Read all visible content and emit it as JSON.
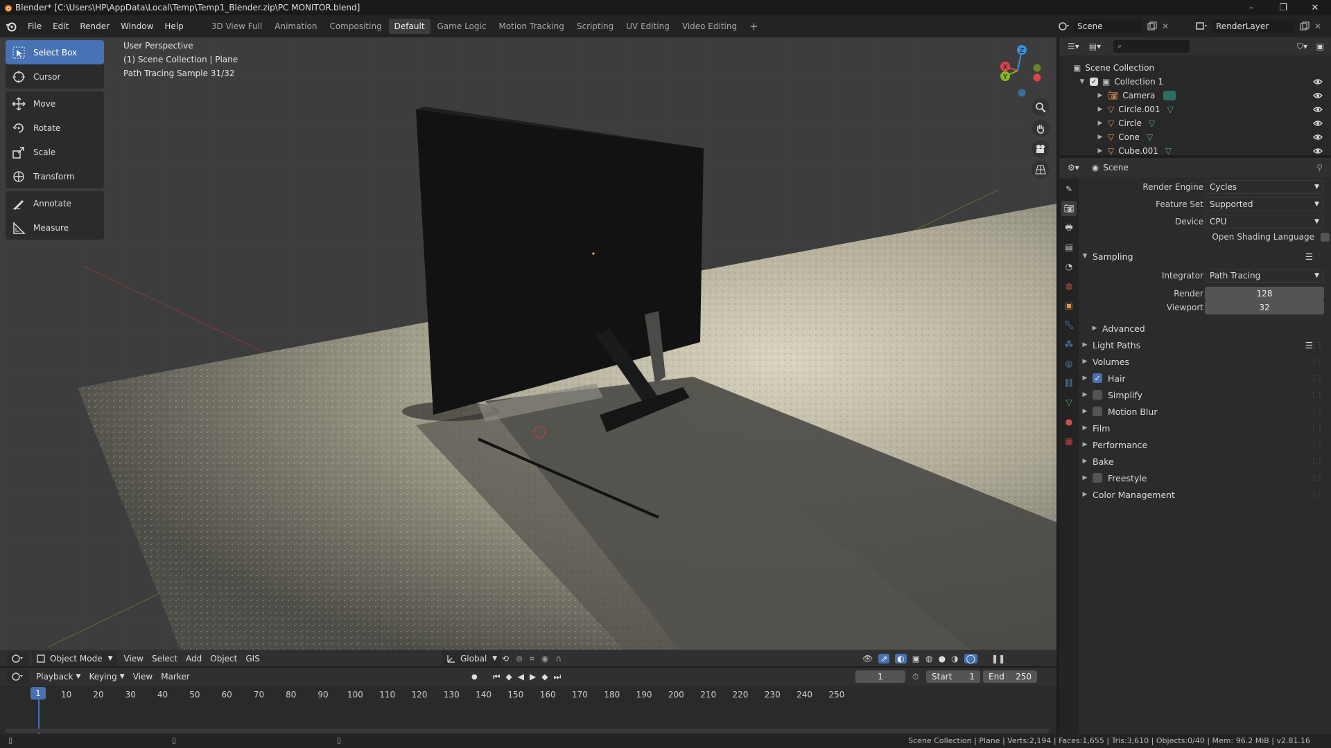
{
  "window": {
    "title": "Blender* [C:\\Users\\HP\\AppData\\Local\\Temp\\Temp1_Blender.zip\\PC MONITOR.blend]",
    "controls": [
      "–",
      "❐",
      "✕"
    ]
  },
  "topbar": {
    "menus": [
      "File",
      "Edit",
      "Render",
      "Window",
      "Help"
    ],
    "workspaces": [
      "3D View Full",
      "Animation",
      "Compositing",
      "Default",
      "Game Logic",
      "Motion Tracking",
      "Scripting",
      "UV Editing",
      "Video Editing"
    ],
    "active_workspace": "Default",
    "add_tab": "+",
    "scene": "Scene",
    "view_layer": "RenderLayer"
  },
  "viewport": {
    "info": [
      "User Perspective",
      "(1) Scene Collection | Plane",
      "Path Tracing Sample 31/32"
    ],
    "tools": [
      {
        "label": "Select Box",
        "icon": "select-box-icon",
        "active": true
      },
      {
        "label": "Cursor",
        "icon": "cursor-icon"
      },
      {
        "label": "Move",
        "icon": "move-icon"
      },
      {
        "label": "Rotate",
        "icon": "rotate-icon"
      },
      {
        "label": "Scale",
        "icon": "scale-icon"
      },
      {
        "label": "Transform",
        "icon": "transform-icon"
      },
      {
        "label": "Annotate",
        "icon": "annotate-icon"
      },
      {
        "label": "Measure",
        "icon": "measure-icon"
      }
    ],
    "gizmo_axes": {
      "x": "X",
      "y": "Y",
      "z": "Z"
    },
    "header": {
      "mode": "Object Mode",
      "menus": [
        "View",
        "Select",
        "Add",
        "Object",
        "GIS"
      ],
      "orientation": "Global"
    }
  },
  "timeline": {
    "menus": [
      "Playback",
      "Keying",
      "View",
      "Marker"
    ],
    "current_frame": "1",
    "start_label": "Start",
    "start": "1",
    "end_label": "End",
    "end": "250",
    "ticks": [
      10,
      20,
      30,
      40,
      50,
      60,
      70,
      80,
      90,
      100,
      110,
      120,
      130,
      140,
      150,
      160,
      170,
      180,
      190,
      200,
      210,
      220,
      230,
      240,
      250
    ],
    "cursor_label": "1"
  },
  "statusbar": {
    "stats": "Scene Collection | Plane | Verts:2,194 | Faces:1,655 | Tris:3,610 | Objects:0/40 | Mem: 96.2 MiB | v2.81.16"
  },
  "outliner": {
    "root": "Scene Collection",
    "collection": "Collection 1",
    "items": [
      {
        "name": "Camera",
        "icon": "camera-object-icon"
      },
      {
        "name": "Circle.001",
        "icon": "mesh-object-icon"
      },
      {
        "name": "Circle",
        "icon": "mesh-object-icon"
      },
      {
        "name": "Cone",
        "icon": "mesh-object-icon"
      },
      {
        "name": "Cube.001",
        "icon": "mesh-object-icon"
      }
    ]
  },
  "properties": {
    "context": "Scene",
    "render_engine_label": "Render Engine",
    "render_engine": "Cycles",
    "feature_set_label": "Feature Set",
    "feature_set": "Supported",
    "device_label": "Device",
    "device": "CPU",
    "osl_label": "Open Shading Language",
    "sampling": {
      "title": "Sampling",
      "integrator_label": "Integrator",
      "integrator": "Path Tracing",
      "render_label": "Render",
      "render": "128",
      "viewport_label": "Viewport",
      "viewport": "32",
      "advanced": "Advanced"
    },
    "panels": [
      {
        "label": "Light Paths",
        "checkbox": null
      },
      {
        "label": "Volumes",
        "checkbox": null
      },
      {
        "label": "Hair",
        "checkbox": true
      },
      {
        "label": "Simplify",
        "checkbox": false
      },
      {
        "label": "Motion Blur",
        "checkbox": false
      },
      {
        "label": "Film",
        "checkbox": null
      },
      {
        "label": "Performance",
        "checkbox": null
      },
      {
        "label": "Bake",
        "checkbox": null
      },
      {
        "label": "Freestyle",
        "checkbox": false
      },
      {
        "label": "Color Management",
        "checkbox": null
      }
    ]
  },
  "colors": {
    "accent": "#4772b3",
    "axis_x": "#e0424b",
    "axis_y": "#85b821",
    "axis_z": "#3b8fdc",
    "viewport_bg": "#3d3d3d"
  }
}
